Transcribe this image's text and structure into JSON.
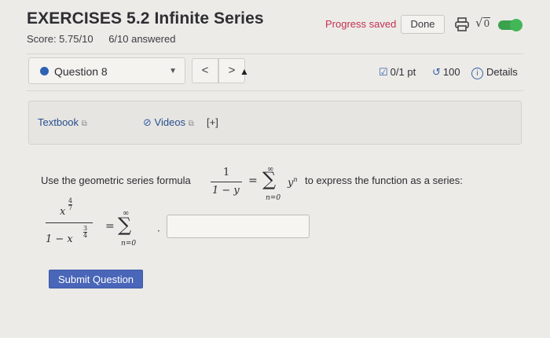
{
  "header": {
    "title": "EXERCISES 5.2 Infinite Series",
    "score": "Score: 5.75/10",
    "answered": "6/10 answered",
    "progress_saved": "Progress saved",
    "done_label": "Done",
    "print_icon": "printer-icon",
    "math_icon_label": "√0",
    "toggle_on": true,
    "accent_color": "#c4304e"
  },
  "question_bar": {
    "question_label": "Question 8",
    "prev_label": "<",
    "next_label": ">",
    "points": "0/1 pt",
    "attempts": "100",
    "details": "Details"
  },
  "resources": {
    "textbook": "Textbook",
    "videos": "Videos",
    "plus": "[+]"
  },
  "question": {
    "prompt_start": "Use the geometric series formula",
    "prompt_end": "to express the function as a series:",
    "formula_numerator": "1",
    "formula_denominator": "1 − y",
    "sum_upper": "∞",
    "sum_lower": "n=0",
    "formula_term": "y",
    "formula_exponent": "n",
    "function_numerator_base": "x",
    "function_numerator_exp_num": "4",
    "function_numerator_exp_den": "7",
    "function_denominator_prefix": "1 − x",
    "function_denominator_exp_num": "3",
    "function_denominator_exp_den": "4",
    "answer_value": ""
  },
  "submit_label": "Submit Question"
}
